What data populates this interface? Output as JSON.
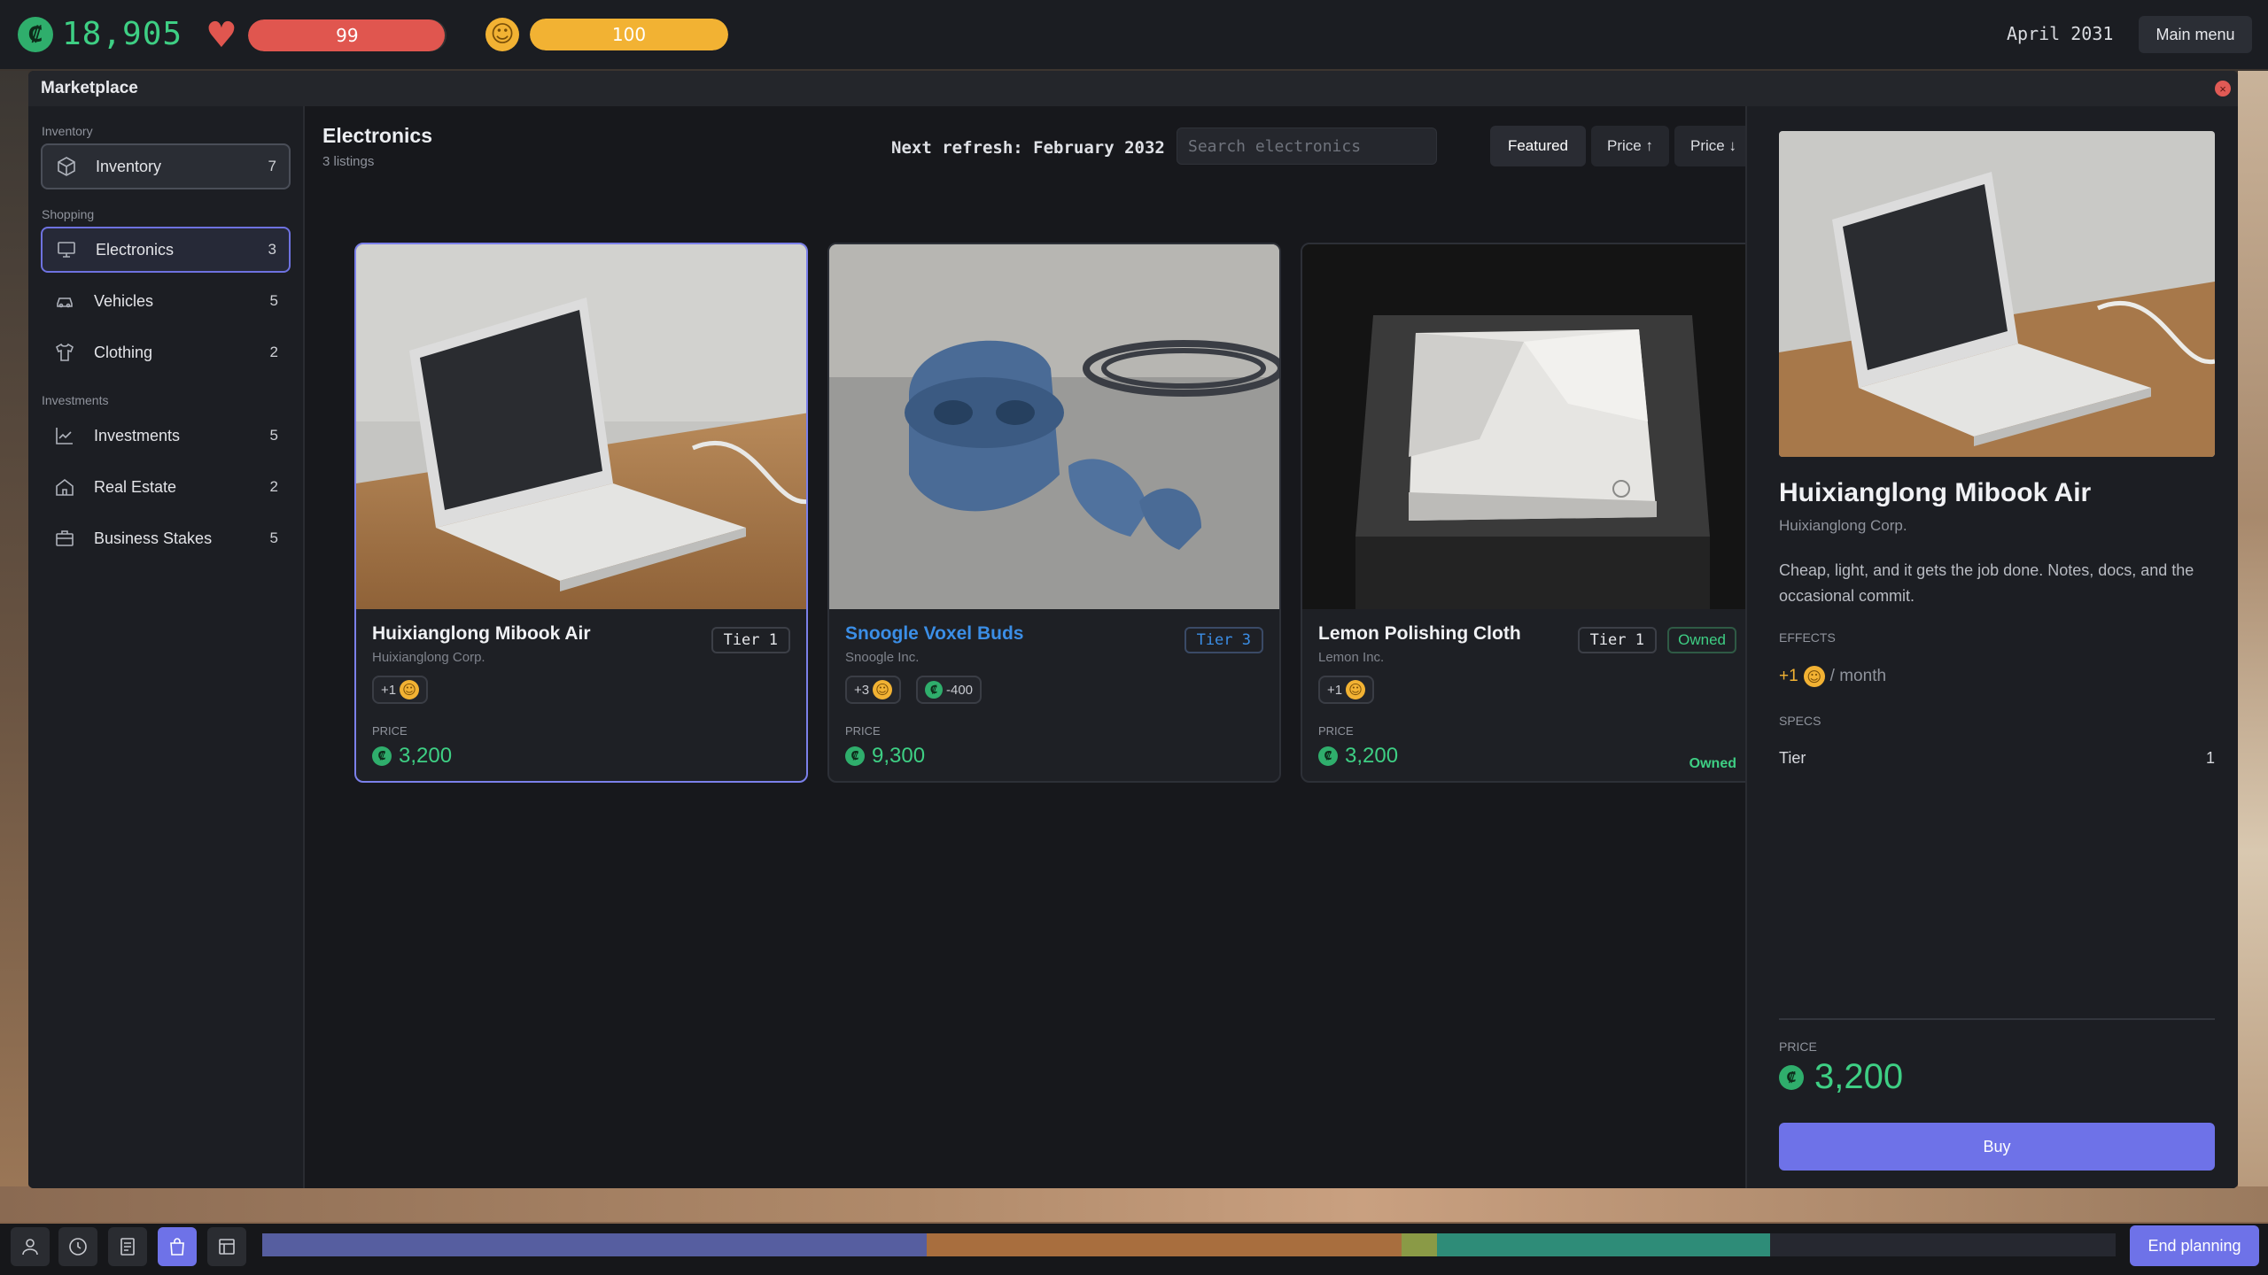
{
  "hud": {
    "money": "18,905",
    "health": {
      "value": "99",
      "fraction": 0.99
    },
    "happiness": {
      "value": "100",
      "fraction": 1.0
    },
    "date": "April 2031",
    "main_menu": "Main menu"
  },
  "window": {
    "title": "Marketplace"
  },
  "sidebar": {
    "sections": [
      {
        "label": "Inventory",
        "items": [
          {
            "label": "Inventory",
            "count": "7",
            "icon": "box-icon"
          }
        ]
      },
      {
        "label": "Shopping",
        "items": [
          {
            "label": "Electronics",
            "count": "3",
            "icon": "monitor-icon"
          },
          {
            "label": "Vehicles",
            "count": "5",
            "icon": "car-icon"
          },
          {
            "label": "Clothing",
            "count": "2",
            "icon": "shirt-icon"
          }
        ]
      },
      {
        "label": "Investments",
        "items": [
          {
            "label": "Investments",
            "count": "5",
            "icon": "chart-line-icon"
          },
          {
            "label": "Real Estate",
            "count": "2",
            "icon": "house-icon"
          },
          {
            "label": "Business Stakes",
            "count": "5",
            "icon": "briefcase-icon"
          }
        ]
      }
    ]
  },
  "main": {
    "title": "Electronics",
    "subtitle": "3 listings",
    "refresh": "Next refresh: February 2032",
    "search_placeholder": "Search electronics",
    "sort": [
      "Featured",
      "Price ↑",
      "Price ↓"
    ]
  },
  "cards": [
    {
      "name": "Huixianglong Mibook Air",
      "corp": "Huixianglong Corp.",
      "tier": "Tier 1",
      "chips": [
        "+1"
      ],
      "price_label": "PRICE",
      "price": "3,200"
    },
    {
      "name": "Snoogle Voxel Buds",
      "corp": "Snoogle Inc.",
      "tier": "Tier 3",
      "chips": [
        "+3",
        "-400"
      ],
      "price_label": "PRICE",
      "price": "9,300"
    },
    {
      "name": "Lemon Polishing Cloth",
      "corp": "Lemon Inc.",
      "tier": "Tier 1",
      "owned_badge": "Owned",
      "chips": [
        "+1"
      ],
      "price_label": "PRICE",
      "price": "3,200",
      "owned_text": "Owned"
    }
  ],
  "detail": {
    "name": "Huixianglong Mibook Air",
    "corp": "Huixianglong Corp.",
    "description": "Cheap, light, and it gets the job done. Notes, docs, and the occasional commit.",
    "effects_label": "EFFECTS",
    "effect_value": "+1",
    "effect_unit": "/ month",
    "specs_label": "SPECS",
    "spec_name": "Tier",
    "spec_value": "1",
    "price_label": "PRICE",
    "price": "3,200",
    "buy": "Buy"
  },
  "bottom": {
    "end_planning": "End planning",
    "icons": [
      "person-icon",
      "clock-icon",
      "document-icon",
      "shopping-bag-icon",
      "ledger-icon"
    ]
  },
  "colors": {
    "accent": "#6e72e8",
    "money": "#3ecf84",
    "health": "#e0564f",
    "happiness": "#f2b233"
  }
}
